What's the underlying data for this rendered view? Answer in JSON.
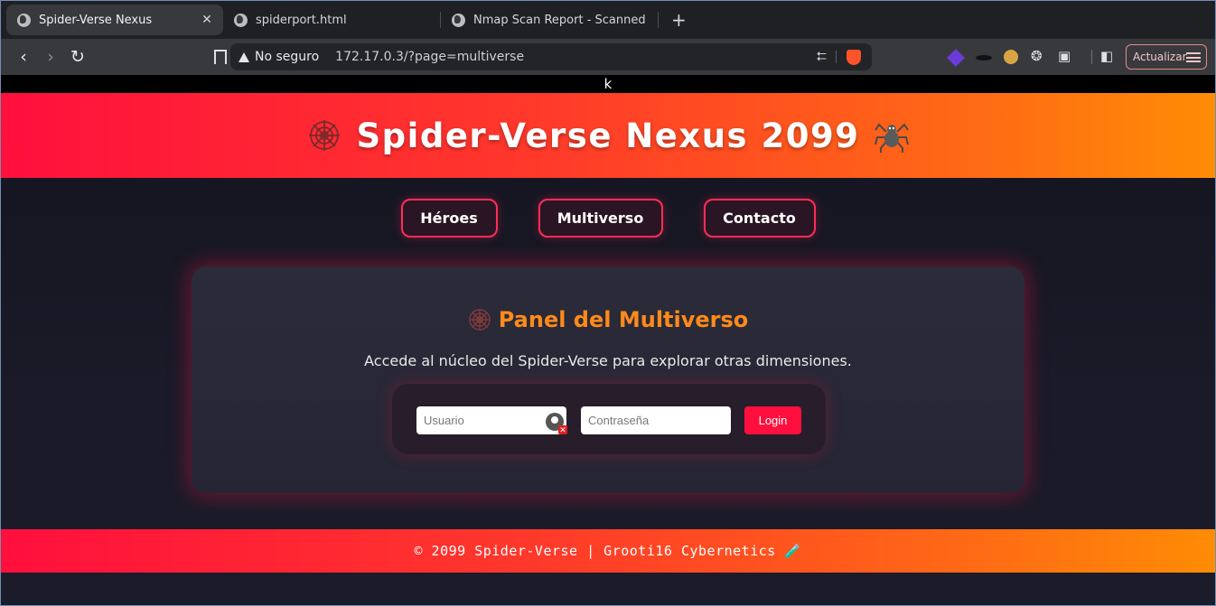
{
  "browser": {
    "tabs": [
      {
        "title": "Spider-Verse Nexus",
        "active": true
      },
      {
        "title": "spiderport.html",
        "active": false
      },
      {
        "title": "Nmap Scan Report - Scanned at Sa",
        "active": false
      }
    ],
    "new_tab_symbol": "+",
    "close_symbol": "✕",
    "security_label": "No seguro",
    "url": "172.17.0.3/?page=multiverse",
    "update_button": "Actualizar"
  },
  "page": {
    "stray_text": "k",
    "header_title": "Spider-Verse Nexus 2099",
    "nav": [
      {
        "label": "Héroes"
      },
      {
        "label": "Multiverso"
      },
      {
        "label": "Contacto"
      }
    ],
    "panel": {
      "title": "Panel del Multiverso",
      "description": "Accede al núcleo del Spider-Verse para explorar otras dimensiones.",
      "username_placeholder": "Usuario",
      "password_placeholder": "Contraseña",
      "login_label": "Login"
    },
    "footer_text": "© 2099 Spider-Verse | Grooti16 Cybernetics 🧪"
  },
  "colors": {
    "accent_red": "#ff0f3d",
    "accent_orange": "#ff8c05",
    "panel_title": "#ff8a1a"
  }
}
